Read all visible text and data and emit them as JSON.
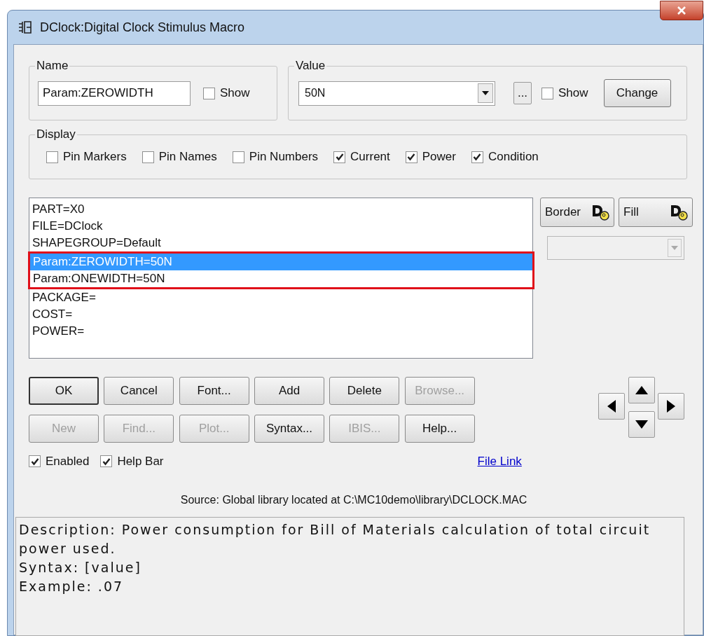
{
  "window": {
    "title": "DClock:Digital Clock Stimulus Macro"
  },
  "name_group": {
    "label": "Name",
    "value": "Param:ZEROWIDTH",
    "show": {
      "label": "Show",
      "checked": false
    }
  },
  "value_group": {
    "label": "Value",
    "value": "50N",
    "ellipsis": "...",
    "show": {
      "label": "Show",
      "checked": false
    },
    "change": "Change"
  },
  "display": {
    "label": "Display",
    "options": [
      {
        "label": "Pin Markers",
        "checked": false
      },
      {
        "label": "Pin Names",
        "checked": false
      },
      {
        "label": "Pin Numbers",
        "checked": false
      },
      {
        "label": "Current",
        "checked": true
      },
      {
        "label": "Power",
        "checked": true
      },
      {
        "label": "Condition",
        "checked": true
      }
    ]
  },
  "attributes": [
    {
      "text": "PART=X0",
      "selected": false,
      "outlined": false
    },
    {
      "text": "FILE=DClock",
      "selected": false,
      "outlined": false
    },
    {
      "text": "SHAPEGROUP=Default",
      "selected": false,
      "outlined": false
    },
    {
      "text": "Param:ZEROWIDTH=50N",
      "selected": true,
      "outlined": true
    },
    {
      "text": "Param:ONEWIDTH=50N",
      "selected": false,
      "outlined": true
    },
    {
      "text": "PACKAGE=",
      "selected": false,
      "outlined": false
    },
    {
      "text": "COST=",
      "selected": false,
      "outlined": false
    },
    {
      "text": "POWER=",
      "selected": false,
      "outlined": false
    }
  ],
  "style_buttons": [
    {
      "label": "Border"
    },
    {
      "label": "Fill"
    }
  ],
  "style_combo": {
    "disabled": true
  },
  "buttons": [
    {
      "label": "OK",
      "disabled": false,
      "default": true
    },
    {
      "label": "Cancel",
      "disabled": false,
      "default": false
    },
    {
      "label": "Font...",
      "disabled": false,
      "default": false
    },
    {
      "label": "Add",
      "disabled": false,
      "default": false
    },
    {
      "label": "Delete",
      "disabled": false,
      "default": false
    },
    {
      "label": "Browse...",
      "disabled": true,
      "default": false
    },
    {
      "label": "New",
      "disabled": true,
      "default": false
    },
    {
      "label": "Find...",
      "disabled": true,
      "default": false
    },
    {
      "label": "Plot...",
      "disabled": true,
      "default": false
    },
    {
      "label": "Syntax...",
      "disabled": false,
      "default": false
    },
    {
      "label": "IBIS...",
      "disabled": true,
      "default": false
    },
    {
      "label": "Help...",
      "disabled": false,
      "default": false
    }
  ],
  "options": [
    {
      "label": "Enabled",
      "checked": true
    },
    {
      "label": "Help Bar",
      "checked": true
    }
  ],
  "file_link": "File Link",
  "source": "Source: Global library located at C:\\MC10demo\\library\\DCLOCK.MAC",
  "help_text": [
    "Description: Power consumption for Bill of Materials calculation of total circuit power used.",
    "Syntax: [value]",
    "Example: .07"
  ]
}
